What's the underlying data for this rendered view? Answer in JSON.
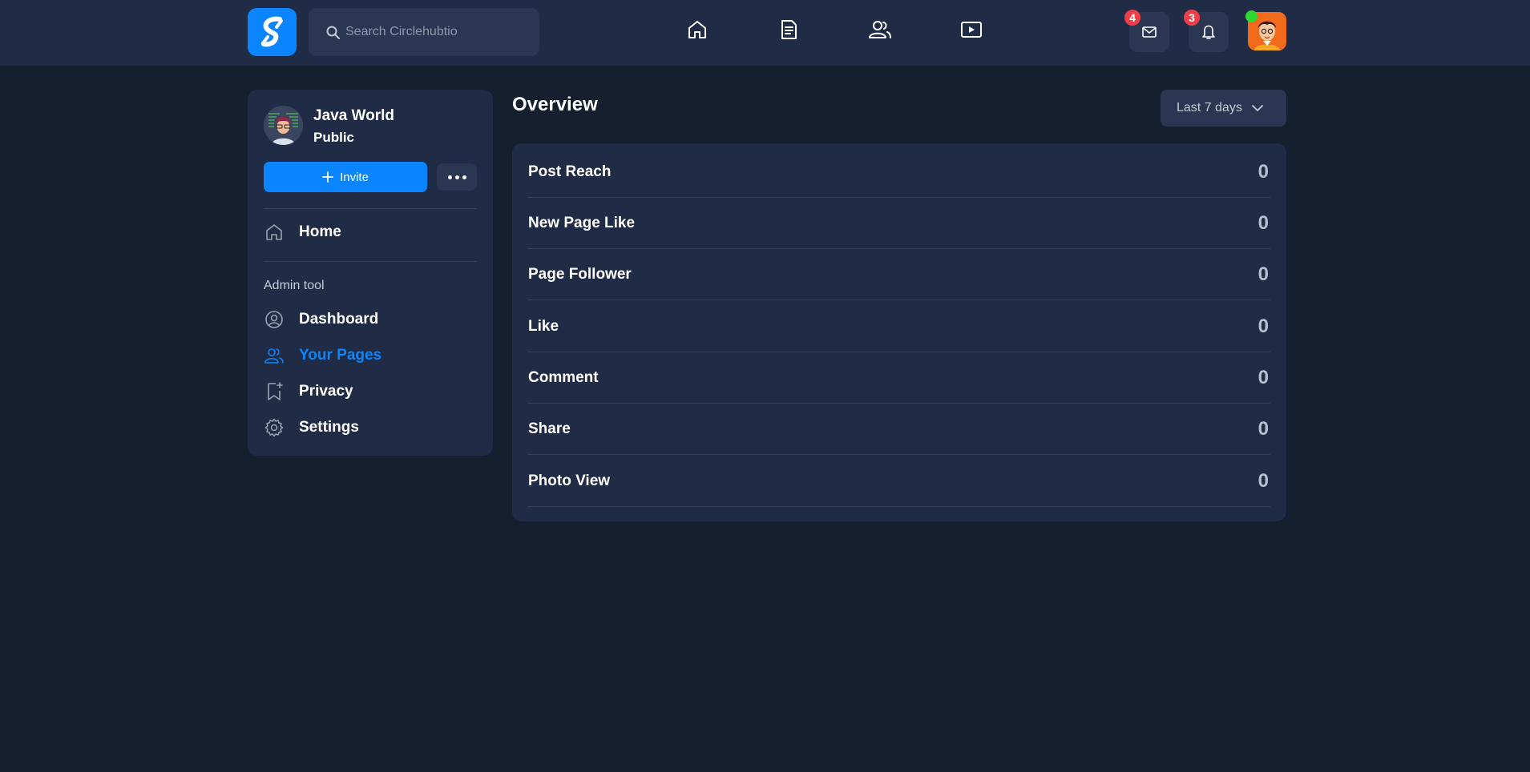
{
  "header": {
    "search": {
      "placeholder": "Search Circlehubtio",
      "value": ""
    },
    "messages_badge": "4",
    "notifications_badge": "3",
    "nav_icons": [
      "home-icon",
      "news-feed-icon",
      "friends-icon",
      "video-icon"
    ]
  },
  "sidebar": {
    "page_name": "Java World",
    "visibility": "Public",
    "invite_label": "Invite",
    "home_label": "Home",
    "section_label": "Admin tool",
    "admin_items": [
      {
        "label": "Dashboard",
        "icon": "dashboard-icon"
      },
      {
        "label": "Your Pages",
        "icon": "users-icon",
        "active": true
      },
      {
        "label": "Privacy",
        "icon": "bookmark-icon"
      },
      {
        "label": "Settings",
        "icon": "gear-icon"
      }
    ]
  },
  "overview": {
    "title": "Overview",
    "range_label": "Last 7 days",
    "stats": [
      {
        "label": "Post Reach",
        "value": "0"
      },
      {
        "label": "New Page Like",
        "value": "0"
      },
      {
        "label": "Page Follower",
        "value": "0"
      },
      {
        "label": "Like",
        "value": "0"
      },
      {
        "label": "Comment",
        "value": "0"
      },
      {
        "label": "Share",
        "value": "0"
      },
      {
        "label": "Photo View",
        "value": "0"
      }
    ]
  },
  "colors": {
    "background": "#161f30",
    "surface": "#202c45",
    "accent": "#0b84ff",
    "badge": "#f03e49",
    "online": "#2ed82e"
  }
}
